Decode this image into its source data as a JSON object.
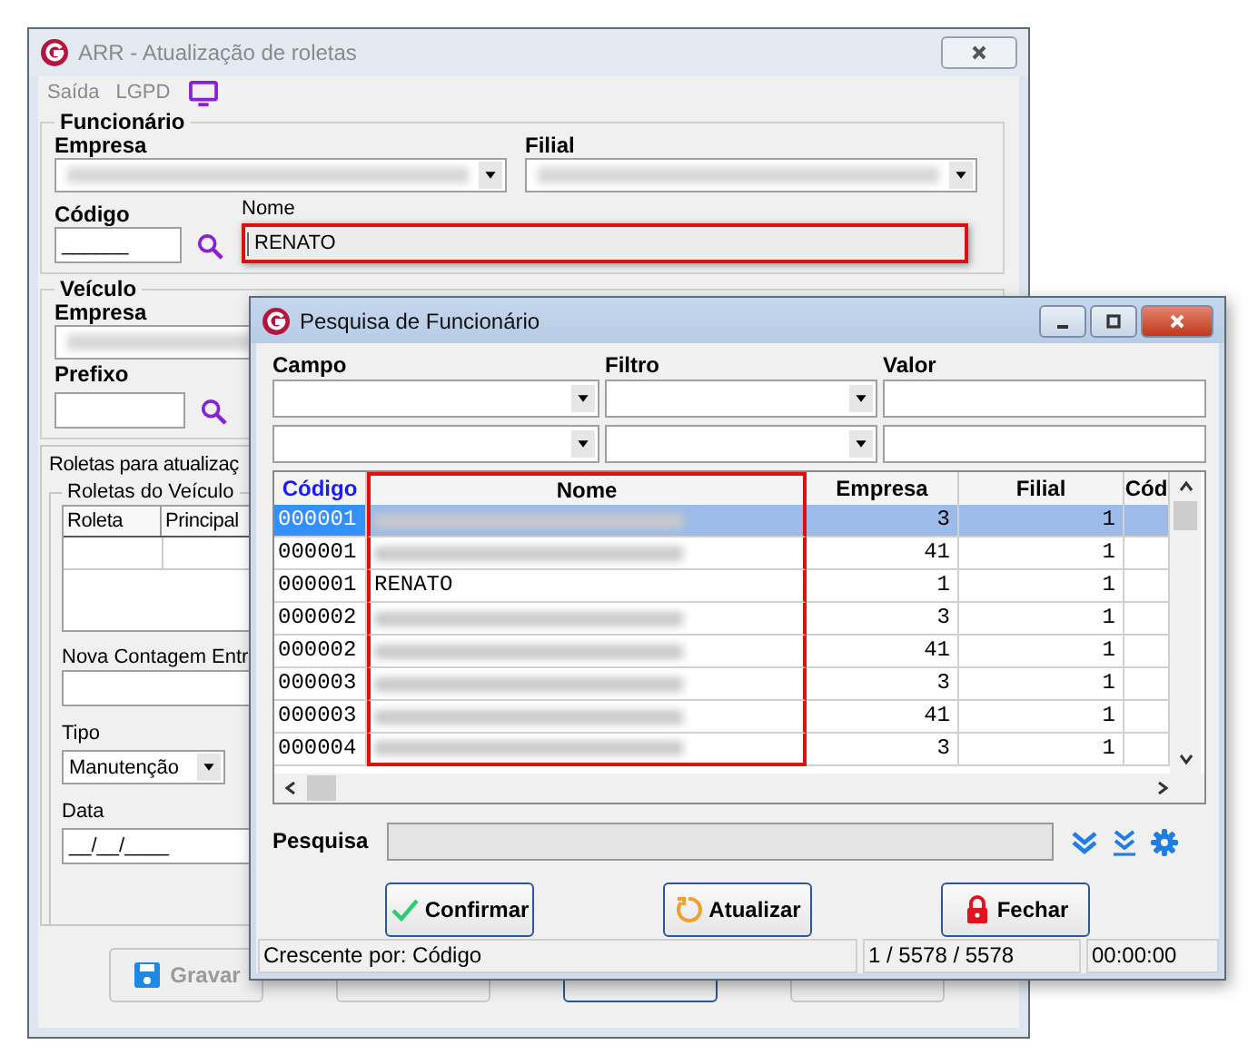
{
  "main_window": {
    "title": "ARR - Atualização de roletas",
    "menu": [
      {
        "label": "Saída"
      },
      {
        "label": "LGPD"
      }
    ],
    "funcionario": {
      "legend": "Funcionário",
      "empresa_label": "Empresa",
      "empresa_redacted": true,
      "filial_label": "Filial",
      "filial_redacted": true,
      "codigo_label": "Código",
      "codigo_value": "______",
      "nome_label": "Nome",
      "nome_value": "RENATO",
      "nome_highlighted": true
    },
    "veiculo": {
      "legend": "Veículo",
      "empresa_label": "Empresa",
      "empresa_redacted": true,
      "prefixo_label": "Prefixo"
    },
    "tab": {
      "label": "Roletas para atualizaç"
    },
    "roletas": {
      "legend": "Roletas do Veículo",
      "columns": [
        "Roleta",
        "Principal"
      ],
      "nova_contagem_label": "Nova Contagem Entr",
      "tipo_label": "Tipo",
      "tipo_value": "Manutenção",
      "data_label": "Data",
      "data_value": "__/__/____"
    },
    "buttons": [
      {
        "kind": "save",
        "label": "Gravar",
        "disabled": true
      },
      {
        "kind": "cancel",
        "disabled": true
      },
      {
        "kind": "clear",
        "disabled": false
      },
      {
        "kind": "delete",
        "disabled": true
      }
    ]
  },
  "dialog": {
    "title": "Pesquisa de Funcionário",
    "filter_labels": [
      "Campo",
      "Filtro",
      "Valor"
    ],
    "grid": {
      "columns": [
        {
          "label": "Código",
          "sorted": true,
          "highlighted": false
        },
        {
          "label": "Nome",
          "sorted": false,
          "highlighted": true
        },
        {
          "label": "Empresa",
          "sorted": false,
          "highlighted": false
        },
        {
          "label": "Filial",
          "sorted": false,
          "highlighted": false
        },
        {
          "label": "Cód",
          "sorted": false,
          "highlighted": false
        }
      ],
      "rows": [
        {
          "codigo": "000001",
          "redacted": true,
          "empresa": "3",
          "filial": "1",
          "selected": true
        },
        {
          "codigo": "000001",
          "redacted": true,
          "empresa": "41",
          "filial": "1",
          "selected": false
        },
        {
          "codigo": "000001",
          "nome": "RENATO",
          "redacted": false,
          "empresa": "1",
          "filial": "1",
          "selected": false
        },
        {
          "codigo": "000002",
          "redacted": true,
          "empresa": "3",
          "filial": "1",
          "selected": false
        },
        {
          "codigo": "000002",
          "redacted": true,
          "empresa": "41",
          "filial": "1",
          "selected": false
        },
        {
          "codigo": "000003",
          "redacted": true,
          "empresa": "3",
          "filial": "1",
          "selected": false
        },
        {
          "codigo": "000003",
          "redacted": true,
          "empresa": "41",
          "filial": "1",
          "selected": false
        },
        {
          "codigo": "000004",
          "redacted": true,
          "empresa": "3",
          "filial": "1",
          "selected": false
        }
      ]
    },
    "search_label": "Pesquisa",
    "buttons": [
      {
        "kind": "confirm",
        "label": "Confirmar"
      },
      {
        "kind": "refresh",
        "label": "Atualizar"
      },
      {
        "kind": "close",
        "label": "Fechar"
      }
    ],
    "status": [
      "Crescente por: Código",
      "1 / 5578 / 5578",
      "00:00:00"
    ]
  }
}
